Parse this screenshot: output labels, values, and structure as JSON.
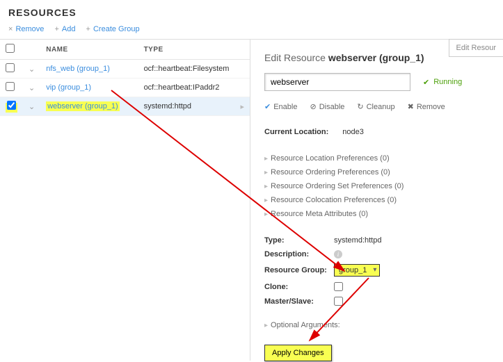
{
  "header": {
    "title": "RESOURCES"
  },
  "toolbar": {
    "remove_icon": "×",
    "remove": "Remove",
    "add_icon": "+",
    "add": "Add",
    "group_icon": "+",
    "group": "Create Group"
  },
  "tab": {
    "edit": "Edit Resour"
  },
  "table": {
    "cols": {
      "name": "NAME",
      "type": "TYPE"
    },
    "rows": [
      {
        "name": "nfs_web (group_1)",
        "type": "ocf::heartbeat:Filesystem",
        "selected": false,
        "hl": false
      },
      {
        "name": "vip (group_1)",
        "type": "ocf::heartbeat:IPaddr2",
        "selected": false,
        "hl": false
      },
      {
        "name": "webserver (group_1)",
        "type": "systemd:httpd",
        "selected": true,
        "hl": true
      }
    ]
  },
  "panel": {
    "title_prefix": "Edit Resource ",
    "title_name": "webserver (group_1)",
    "input_value": "webserver",
    "status": "Running",
    "actions": {
      "enable": "Enable",
      "disable": "Disable",
      "cleanup": "Cleanup",
      "remove": "Remove"
    },
    "location_label": "Current Location:",
    "location_value": "node3",
    "prefs": [
      "Resource Location Preferences (0)",
      "Resource Ordering Preferences (0)",
      "Resource Ordering Set Preferences (0)",
      "Resource Colocation Preferences (0)",
      "Resource Meta Attributes (0)"
    ],
    "props": {
      "type_label": "Type:",
      "type_value": "systemd:httpd",
      "desc_label": "Description:",
      "group_label": "Resource Group:",
      "group_value": "group_1",
      "clone_label": "Clone:",
      "ms_label": "Master/Slave:"
    },
    "optional": "Optional Arguments:",
    "apply": "Apply Changes"
  }
}
